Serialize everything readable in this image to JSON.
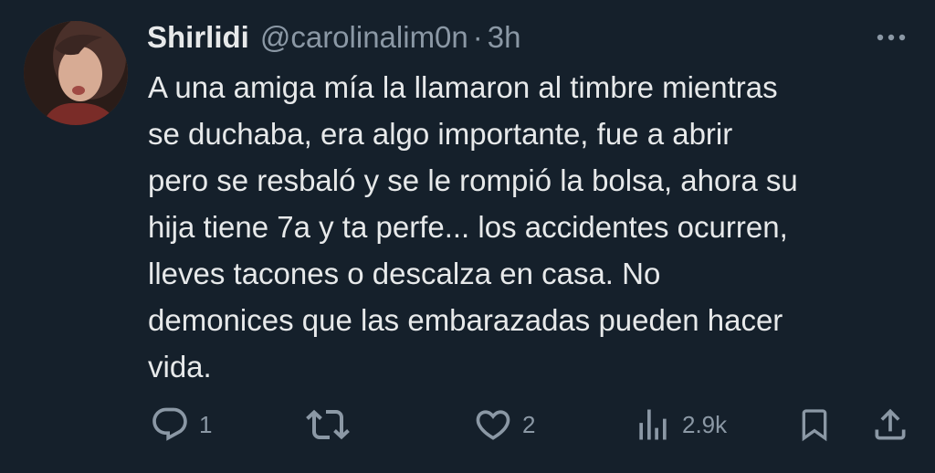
{
  "tweet": {
    "author_name": "Shirlidi",
    "handle": "@carolinalim0n",
    "separator": "·",
    "time": "3h",
    "text": "A una amiga mía la llamaron al timbre mientras\nse duchaba, era algo importante, fue a abrir\npero se resbaló y se le rompió la bolsa, ahora su\nhija tiene 7a y ta perfe... los accidentes ocurren,\nlleves tacones o descalza en casa. No\ndemonices que las embarazadas pueden hacer\nvida.",
    "avatar_icon": "profile-photo",
    "more_icon": "more-dots-icon"
  },
  "actions": {
    "reply": {
      "icon": "reply-icon",
      "count": "1"
    },
    "retweet": {
      "icon": "retweet-icon",
      "count": ""
    },
    "like": {
      "icon": "heart-icon",
      "count": "2"
    },
    "views": {
      "icon": "views-icon",
      "count": "2.9k"
    },
    "bookmark": {
      "icon": "bookmark-icon"
    },
    "share": {
      "icon": "share-icon"
    }
  },
  "colors": {
    "background": "#15202b",
    "primary_text": "#e7e9ea",
    "secondary_text": "#8b98a5"
  }
}
